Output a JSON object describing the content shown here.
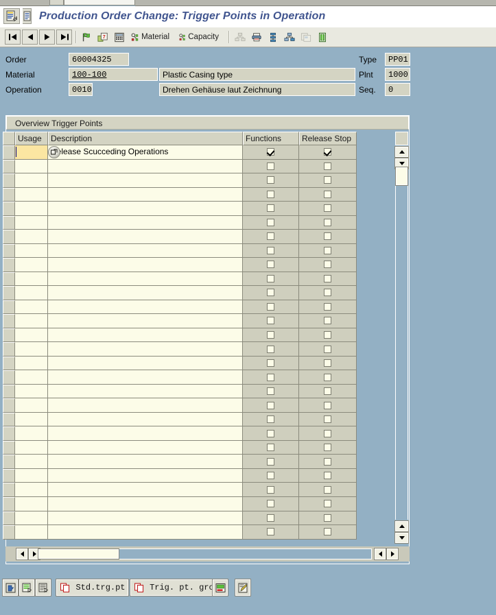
{
  "window": {
    "title": "Production Order Change: Trigger Points in Operation",
    "title_icon": "sap-document-icon",
    "title_icon_secondary": "sap-list-icon"
  },
  "toolbar": {
    "buttons": [
      {
        "name": "first-page-button",
        "icon": "first-page-icon",
        "label": ""
      },
      {
        "name": "previous-page-button",
        "icon": "previous-page-icon",
        "label": ""
      },
      {
        "name": "next-page-button",
        "icon": "next-page-icon",
        "label": ""
      },
      {
        "name": "last-page-button",
        "icon": "last-page-icon",
        "label": ""
      },
      {
        "name": "flag-button",
        "icon": "flag-icon",
        "label": ""
      },
      {
        "name": "documents-button",
        "icon": "documents-icon",
        "label": ""
      },
      {
        "name": "calculator-button",
        "icon": "calculator-icon",
        "label": ""
      },
      {
        "name": "material-button",
        "icon": "material-icon",
        "label": "Material"
      },
      {
        "name": "capacity-button",
        "icon": "capacity-icon",
        "label": "Capacity"
      },
      {
        "name": "hierarchy-button",
        "icon": "hierarchy-icon",
        "label": ""
      },
      {
        "name": "print-button",
        "icon": "printer-icon",
        "label": ""
      },
      {
        "name": "sequence-button",
        "icon": "sequence-icon",
        "label": ""
      },
      {
        "name": "network-button",
        "icon": "network-icon",
        "label": ""
      },
      {
        "name": "copy-button",
        "icon": "copy-icon",
        "label": ""
      },
      {
        "name": "log-button",
        "icon": "log-icon",
        "label": ""
      }
    ]
  },
  "header_form": {
    "order_label": "Order",
    "order_value": "60004325",
    "type_label": "Type",
    "type_value": "PP01",
    "material_label": "Material",
    "material_value": "100-100",
    "material_desc": "Plastic Casing type",
    "plant_label": "Plnt",
    "plant_value": "1000",
    "operation_label": "Operation",
    "operation_value": "0010",
    "operation_desc": "Drehen Gehäuse laut Zeichnung",
    "seq_label": "Seq.",
    "seq_value": "0"
  },
  "group": {
    "title": "Overview Trigger Points"
  },
  "table": {
    "columns": [
      {
        "key": "usage",
        "label": "Usage"
      },
      {
        "key": "desc",
        "label": "Description"
      },
      {
        "key": "func",
        "label": "Functions"
      },
      {
        "key": "release",
        "label": "Release Stop"
      }
    ],
    "row_count": 28,
    "rows": [
      {
        "usage": "",
        "desc": "Release Scucceding Operations",
        "func": true,
        "release": true,
        "active": true,
        "cursor": true
      },
      {
        "usage": "",
        "desc": "",
        "func": false,
        "release": false
      },
      {
        "usage": "",
        "desc": "",
        "func": false,
        "release": false
      },
      {
        "usage": "",
        "desc": "",
        "func": false,
        "release": false
      },
      {
        "usage": "",
        "desc": "",
        "func": false,
        "release": false
      },
      {
        "usage": "",
        "desc": "",
        "func": false,
        "release": false
      },
      {
        "usage": "",
        "desc": "",
        "func": false,
        "release": false
      },
      {
        "usage": "",
        "desc": "",
        "func": false,
        "release": false
      },
      {
        "usage": "",
        "desc": "",
        "func": false,
        "release": false
      },
      {
        "usage": "",
        "desc": "",
        "func": false,
        "release": false
      },
      {
        "usage": "",
        "desc": "",
        "func": false,
        "release": false
      },
      {
        "usage": "",
        "desc": "",
        "func": false,
        "release": false
      },
      {
        "usage": "",
        "desc": "",
        "func": false,
        "release": false
      },
      {
        "usage": "",
        "desc": "",
        "func": false,
        "release": false
      },
      {
        "usage": "",
        "desc": "",
        "func": false,
        "release": false
      },
      {
        "usage": "",
        "desc": "",
        "func": false,
        "release": false
      },
      {
        "usage": "",
        "desc": "",
        "func": false,
        "release": false
      },
      {
        "usage": "",
        "desc": "",
        "func": false,
        "release": false
      },
      {
        "usage": "",
        "desc": "",
        "func": false,
        "release": false
      },
      {
        "usage": "",
        "desc": "",
        "func": false,
        "release": false
      },
      {
        "usage": "",
        "desc": "",
        "func": false,
        "release": false
      },
      {
        "usage": "",
        "desc": "",
        "func": false,
        "release": false
      },
      {
        "usage": "",
        "desc": "",
        "func": false,
        "release": false
      },
      {
        "usage": "",
        "desc": "",
        "func": false,
        "release": false
      },
      {
        "usage": "",
        "desc": "",
        "func": false,
        "release": false
      },
      {
        "usage": "",
        "desc": "",
        "func": false,
        "release": false
      },
      {
        "usage": "",
        "desc": "",
        "func": false,
        "release": false
      },
      {
        "usage": "",
        "desc": "",
        "func": false,
        "release": false
      }
    ]
  },
  "scrollbars": {
    "vertical_up_icon": "arrow-up-icon",
    "vertical_down_icon": "arrow-down-icon",
    "horizontal_left_icon": "arrow-left-icon",
    "horizontal_right_icon": "arrow-right-icon"
  },
  "bottom_bar": {
    "buttons": [
      {
        "name": "insert-row-button",
        "icon": "insert-row-icon",
        "label": ""
      },
      {
        "name": "select-entries-button",
        "icon": "select-list-icon",
        "label": ""
      },
      {
        "name": "deselect-entries-button",
        "icon": "deselect-list-icon",
        "label": ""
      },
      {
        "name": "std-trigger-point-button",
        "icon": "copy-icon",
        "label": "Std.trg.pt"
      },
      {
        "name": "trigger-point-group-button",
        "icon": "copy-icon",
        "label": "Trig. pt. grou"
      },
      {
        "name": "details-button",
        "icon": "details-icon",
        "label": ""
      },
      {
        "name": "edit-button",
        "icon": "edit-pencil-icon",
        "label": ""
      }
    ]
  },
  "colors": {
    "background": "#93b0c4",
    "title_text": "#41558f",
    "field_bg": "#d4d4c3",
    "row_bg": "#fcfce8",
    "row_active": "#fbe6a2",
    "checkbox_col_bg": "#cfcfbe",
    "toolbar_bg": "#e9e9e0"
  }
}
